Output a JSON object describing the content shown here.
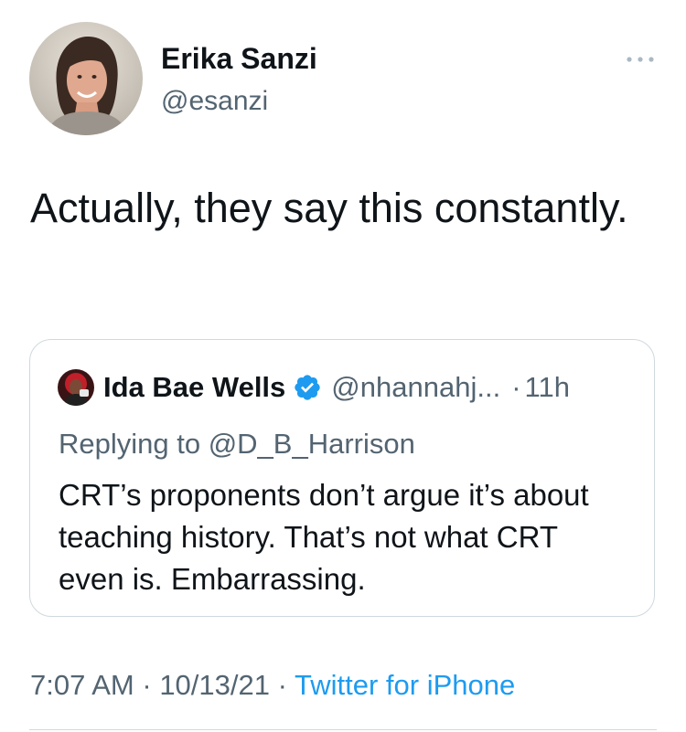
{
  "tweet": {
    "author": {
      "name": "Erika Sanzi",
      "handle": "@esanzi"
    },
    "text": "Actually, they say this constantly.",
    "quoted": {
      "name": "Ida Bae Wells",
      "handle": "@nhannahj...",
      "separator": "·",
      "time": "11h",
      "replying_to": "Replying to @D_B_Harrison",
      "text": "CRT’s proponents don’t argue it’s about teaching history. That’s not what CRT even is. Embarrassing."
    },
    "meta": {
      "time": "7:07 AM",
      "date": "10/13/21",
      "separator": "·",
      "source": "Twitter for iPhone"
    }
  },
  "icons": {
    "more": "more-horizontal-icon",
    "verified": "verified-badge-icon"
  },
  "colors": {
    "text_primary": "#0f1419",
    "text_secondary": "#536471",
    "accent": "#1d9bf0",
    "border": "#cfd9de"
  }
}
